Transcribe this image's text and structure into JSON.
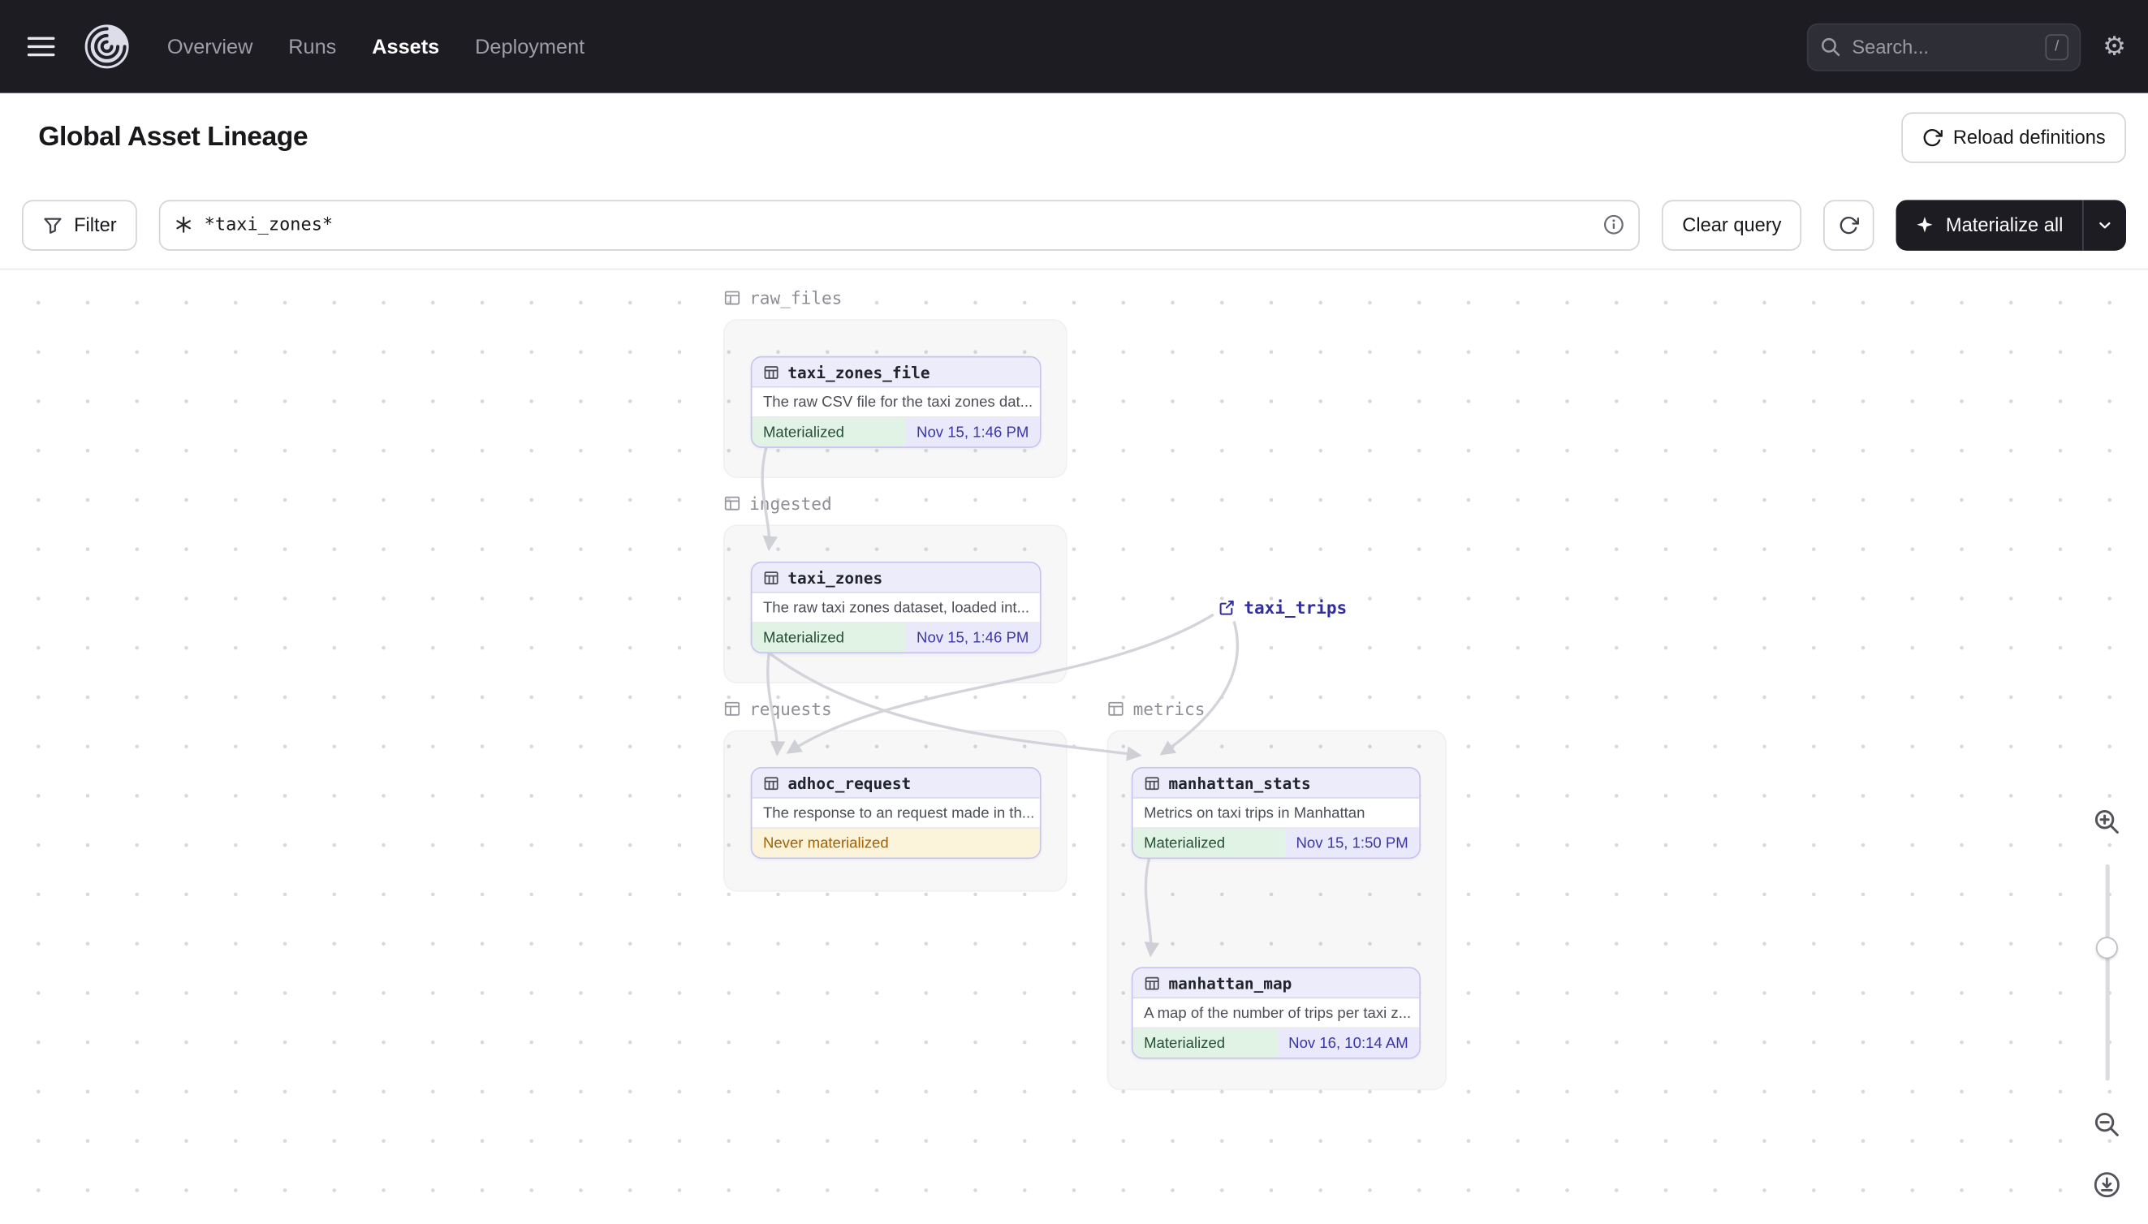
{
  "nav": {
    "items": [
      {
        "label": "Overview",
        "active": false
      },
      {
        "label": "Runs",
        "active": false
      },
      {
        "label": "Assets",
        "active": true
      },
      {
        "label": "Deployment",
        "active": false
      }
    ],
    "search_placeholder": "Search...",
    "search_shortcut": "/"
  },
  "header": {
    "title": "Global Asset Lineage",
    "reload_button": "Reload definitions"
  },
  "toolbar": {
    "filter_button": "Filter",
    "query_value": "*taxi_zones*",
    "clear_button": "Clear query",
    "materialize_button": "Materialize all"
  },
  "graph": {
    "groups": [
      {
        "label": "raw_files"
      },
      {
        "label": "ingested"
      },
      {
        "label": "requests"
      },
      {
        "label": "metrics"
      }
    ],
    "nodes": [
      {
        "name": "taxi_zones_file",
        "group": "raw_files",
        "description": "The raw CSV file for the taxi zones dat...",
        "status": "Materialized",
        "timestamp": "Nov 15, 1:46 PM"
      },
      {
        "name": "taxi_zones",
        "group": "ingested",
        "description": "The raw taxi zones dataset, loaded int...",
        "status": "Materialized",
        "timestamp": "Nov 15, 1:46 PM"
      },
      {
        "name": "adhoc_request",
        "group": "requests",
        "description": "The response to an request made in th...",
        "status": "Never materialized",
        "timestamp": ""
      },
      {
        "name": "manhattan_stats",
        "group": "metrics",
        "description": "Metrics on taxi trips in Manhattan",
        "status": "Materialized",
        "timestamp": "Nov 15, 1:50 PM"
      },
      {
        "name": "manhattan_map",
        "group": "metrics",
        "description": "A map of the number of trips per taxi z...",
        "status": "Materialized",
        "timestamp": "Nov 16, 10:14 AM"
      }
    ],
    "external_assets": [
      {
        "name": "taxi_trips"
      }
    ],
    "edges": [
      {
        "from": "taxi_zones_file",
        "to": "taxi_zones"
      },
      {
        "from": "taxi_zones",
        "to": "adhoc_request"
      },
      {
        "from": "taxi_zones",
        "to": "manhattan_stats"
      },
      {
        "from": "taxi_trips",
        "to": "adhoc_request"
      },
      {
        "from": "taxi_trips",
        "to": "manhattan_stats"
      },
      {
        "from": "manhattan_stats",
        "to": "manhattan_map"
      }
    ]
  },
  "colors": {
    "nav_bg": "#1c1c22",
    "node_border": "#c7c3ee",
    "node_header_bg": "#edecfb",
    "node_header_border": "#d8d5f2",
    "materialized_bg": "#e1f3e5",
    "materialized_text": "#264f33",
    "timestamp_bg": "#eae9fb",
    "timestamp_text": "#3a35a5",
    "warn_bg": "#fbf3da",
    "warn_text": "#a16207",
    "edge": "#d3d3d9",
    "external_link": "#322f9d"
  }
}
